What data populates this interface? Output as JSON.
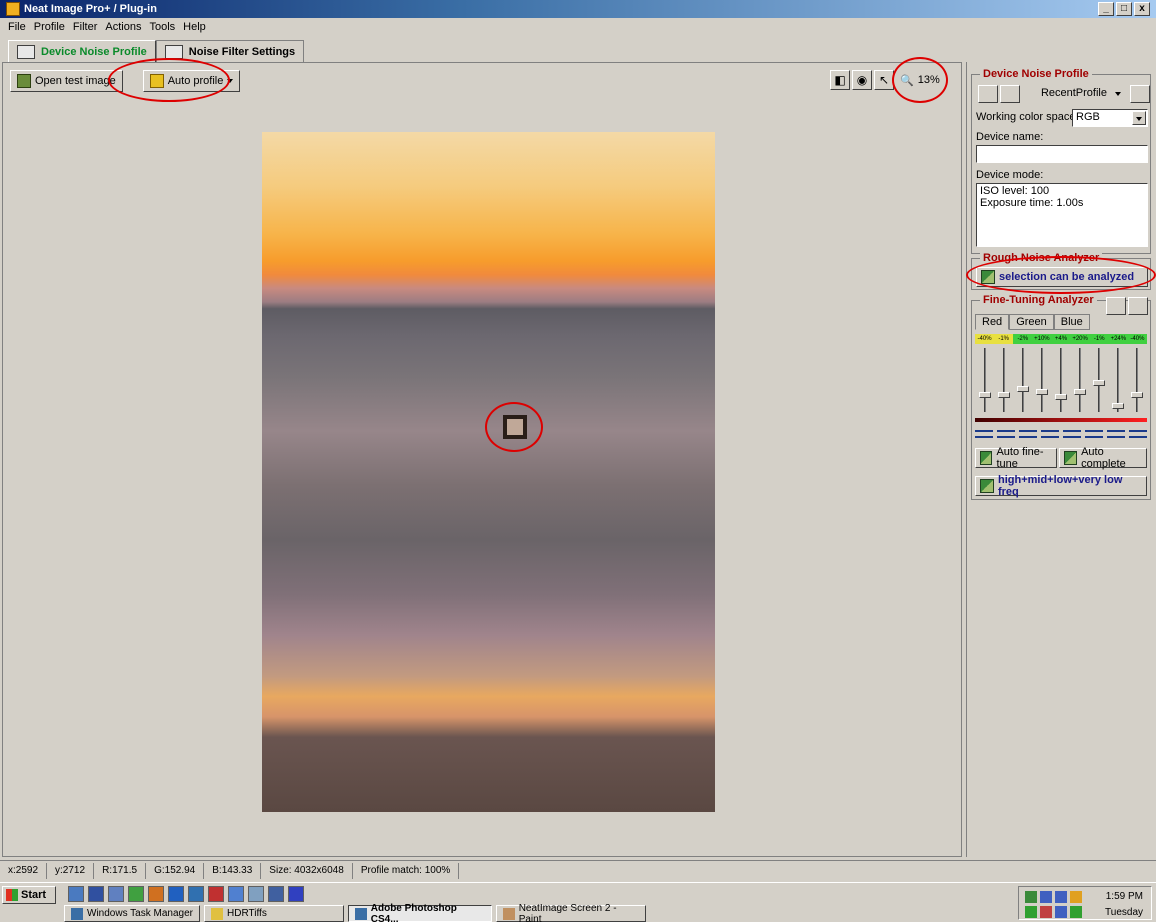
{
  "window": {
    "title": "Neat Image Pro+ / Plug-in",
    "min": "_",
    "max": "□",
    "close": "x"
  },
  "menu": [
    "File",
    "Profile",
    "Filter",
    "Actions",
    "Tools",
    "Help"
  ],
  "tabs": [
    {
      "label": "Device Noise Profile",
      "active": true
    },
    {
      "label": "Noise Filter Settings",
      "active": false
    }
  ],
  "toolbar": {
    "open_label": "Open test image",
    "auto_profile_label": "Auto profile",
    "zoom": "13%"
  },
  "sidebar": {
    "profile_group_title": "Device Noise Profile",
    "recent_profile": "RecentProfile",
    "color_space_label": "Working color space:",
    "color_space_value": "RGB",
    "device_name_label": "Device name:",
    "device_name_value": "",
    "device_mode_label": "Device mode:",
    "device_mode_line1": "ISO level: 100",
    "device_mode_line2": "Exposure time: 1.00s",
    "rough_title": "Rough Noise Analyzer",
    "rough_button": "selection can be analyzed",
    "fine_title": "Fine-Tuning Analyzer",
    "channel_tabs": [
      "Red",
      "Green",
      "Blue"
    ],
    "scale": [
      "-40%",
      "-1%",
      "-2%",
      "+10%",
      "+4%",
      "+20%",
      "-1%",
      "+24%",
      "-40%"
    ],
    "slider_levels": [
      0.25,
      0.25,
      0.35,
      0.3,
      0.2,
      0.3,
      0.45,
      0.05,
      0.25
    ],
    "auto_fine_tune": "Auto fine-tune",
    "auto_complete": "Auto complete",
    "freq_button": "high+mid+low+very low freq"
  },
  "status": {
    "x": "x:2592",
    "y": "y:2712",
    "r": "R:171.5",
    "g": "G:152.94",
    "b": "B:143.33",
    "size": "Size: 4032x6048",
    "profile_match": "Profile match: 100%"
  },
  "taskbar": {
    "start": "Start",
    "tasks": [
      {
        "label": "Windows Task Manager",
        "active": false
      },
      {
        "label": "HDRTiffs",
        "active": false
      },
      {
        "label": "Adobe Photoshop CS4...",
        "active": true
      },
      {
        "label": "NeatImage Screen 2 - Paint",
        "active": false
      }
    ],
    "time": "1:59 PM",
    "day": "Tuesday"
  }
}
